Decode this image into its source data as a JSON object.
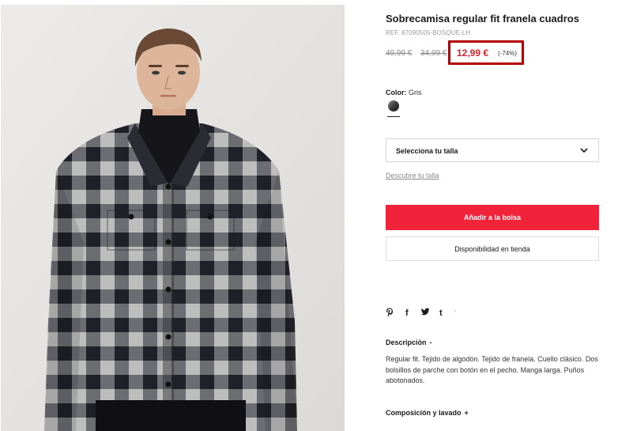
{
  "product": {
    "title": "Sobrecamisa regular fit franela cuadros",
    "ref": "REF. 87090505-BOSQUE-LH",
    "prices": {
      "original": "49,99 €",
      "previous": "34,99 €",
      "current": "12,99 €",
      "discount": "(-74%)"
    },
    "color": {
      "label": "Color:",
      "value": "Gris"
    },
    "size_select": {
      "label": "Selecciona tu talla"
    },
    "size_guide_link": "Descubre tu talla",
    "add_to_bag_label": "Añadir a la bolsa",
    "store_availability_label": "Disponibilidad en tienda",
    "share_icons": [
      "pinterest-icon",
      "facebook-icon",
      "twitter-icon",
      "tumblr-icon"
    ],
    "sections": {
      "description": {
        "title": "Descripción",
        "toggle": "-",
        "text": "Regular fit. Tejido de algodón. Tejido de franela. Cuello clásico. Dos bolsillos de parche con botón en el pecho. Manga larga. Puños abotonados."
      },
      "composition": {
        "title": "Composición y lavado",
        "toggle": "+"
      }
    }
  },
  "colors": {
    "accent": "#f0233b",
    "sale_price": "#d6202a",
    "highlight_box": "#b40000"
  }
}
